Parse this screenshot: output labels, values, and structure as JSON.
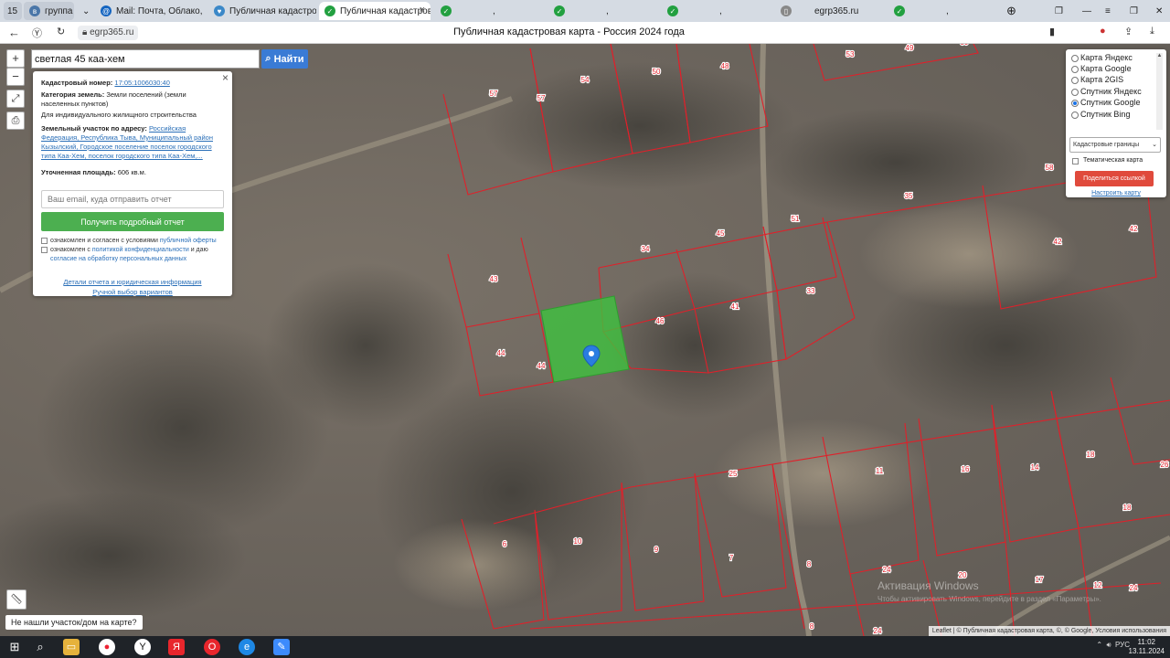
{
  "browser": {
    "tab_counter": "15",
    "tabs": [
      {
        "label": "группа 1",
        "icon": "vk-icon"
      },
      {
        "label": "Mail: Почта, Облако, Календ",
        "icon": "mail-icon"
      },
      {
        "label": "Публичная кадастровая",
        "icon": "shield-icon"
      },
      {
        "label": "Публичная кадастровая",
        "icon": "check-icon",
        "active": true
      },
      {
        "label": ",",
        "icon": "check-icon"
      },
      {
        "label": ",",
        "icon": "check-icon"
      },
      {
        "label": ",",
        "icon": "check-icon"
      },
      {
        "label": "egrp365.ru",
        "icon": "document-icon"
      },
      {
        "label": ",",
        "icon": "check-icon"
      }
    ],
    "url": "egrp365.ru",
    "page_title": "Публичная кадастровая карта - Россия 2024 года"
  },
  "search": {
    "value": "светлая 45 каа-хем",
    "button_label": "Найти"
  },
  "info": {
    "cadastral_label": "Кадастровый номер:",
    "cadastral_number": "17:05:1006030:40",
    "category_label": "Категория земель:",
    "category_value": "Земли поселений (земли населенных пунктов)",
    "usage": "Для индивидуального жилищного строительства",
    "address_label": "Земельный участок по адресу:",
    "address_value": "Российская Федерация, Республика Тыва, Муниципальный район Кызылский, Городское поселение поселок городского типа Каа-Хем, поселок городского типа Каа-Хем,...",
    "area_label": "Уточненная площадь:",
    "area_value": "606 кв.м.",
    "email_placeholder": "Ваш email, куда отправить отчет",
    "report_button": "Получить подробный отчет",
    "agree1_text": "ознакомлен и согласен с условиями",
    "agree1_link": "публичной оферты",
    "agree2_text": "ознакомлен с",
    "agree2_link": "политикой конфиденциальности",
    "agree2_tail": "и даю",
    "agree2_link2": "согласие на обработку персональных данных",
    "details_link": "Детали отчета и юридическая информация",
    "manual_link": "Ручной выбор вариантов"
  },
  "layers": {
    "options": [
      "Карта Яндекс",
      "Карта Google",
      "Карта 2GIS",
      "Спутник Яндекс",
      "Спутник Google",
      "Спутник Bing"
    ],
    "selected": "Спутник Google",
    "cadastral_select": "Кадастровые границы",
    "thematic_label": "Тематическая карта",
    "share_button": "Поделиться ссылкой",
    "configure_link": "Настроить карту"
  },
  "map": {
    "parcel_numbers": [
      "57",
      "57",
      "54",
      "50",
      "48",
      "53",
      "49",
      "39",
      "58",
      "35",
      "51",
      "45",
      "34",
      "42",
      "42",
      "43",
      "33",
      "41",
      "46",
      "44",
      "44",
      "25",
      "11",
      "16",
      "14",
      "18",
      "26",
      "6",
      "10",
      "9",
      "7",
      "8",
      "24",
      "20",
      "17",
      "12",
      "24",
      "18",
      "8",
      "24"
    ],
    "selected_color": "#3ec23e",
    "boundary_color": "#e0202a",
    "not_found_label": "Не нашли участок/дом на карте?",
    "attribution": "Leaflet | © Публичная кадастровая карта, ©, © Google, Условия использования",
    "watermark1": "Активация Windows",
    "watermark2": "Чтобы активировать Windows, перейдите в раздел «Параметры»."
  },
  "taskbar": {
    "lang": "РУС",
    "time": "11:02",
    "date": "13.11.2024"
  }
}
